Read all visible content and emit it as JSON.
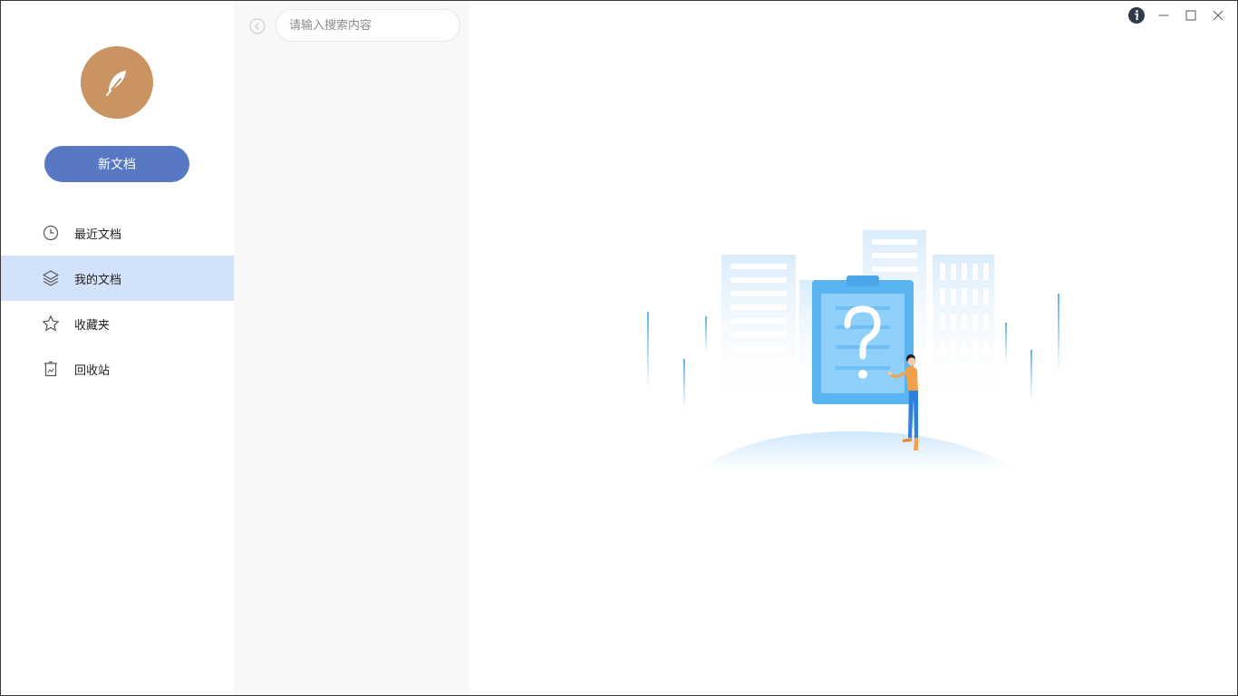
{
  "sidebar": {
    "avatar_icon": "feather-icon",
    "new_doc_label": "新文档",
    "items": [
      {
        "label": "最近文档",
        "icon": "clock-icon",
        "active": false
      },
      {
        "label": "我的文档",
        "icon": "layers-icon",
        "active": true
      },
      {
        "label": "收藏夹",
        "icon": "star-icon",
        "active": false
      },
      {
        "label": "回收站",
        "icon": "trash-icon",
        "active": false
      }
    ]
  },
  "list_panel": {
    "search_placeholder": "请输入搜索内容",
    "search_value": "",
    "collapse_icon": "chevron-left-circle-icon"
  },
  "window_controls": {
    "icons": [
      "info-icon",
      "minimize-icon",
      "maximize-icon",
      "close-icon"
    ]
  },
  "colors": {
    "accent": "#5878c4",
    "avatar": "#c99461",
    "active_nav": "#d3e2fb",
    "list_bg": "#f8f8f8",
    "illustration_blue": "#5ab4f0"
  }
}
